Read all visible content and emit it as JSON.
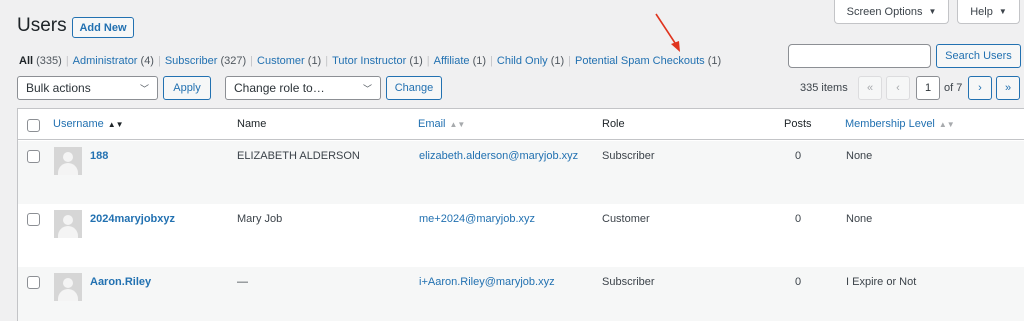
{
  "header": {
    "title": "Users",
    "add_new_label": "Add New",
    "screen_options_label": "Screen Options",
    "help_label": "Help"
  },
  "filters": {
    "all": {
      "label": "All",
      "count": "(335)"
    },
    "items": [
      {
        "label": "Administrator",
        "count": "(4)"
      },
      {
        "label": "Subscriber",
        "count": "(327)"
      },
      {
        "label": "Customer",
        "count": "(1)"
      },
      {
        "label": "Tutor Instructor",
        "count": "(1)"
      },
      {
        "label": "Affiliate",
        "count": "(1)"
      },
      {
        "label": "Child Only",
        "count": "(1)"
      },
      {
        "label": "Potential Spam Checkouts",
        "count": "(1)"
      }
    ]
  },
  "search": {
    "value": "",
    "button_label": "Search Users"
  },
  "tablenav": {
    "bulk_actions_label": "Bulk actions",
    "apply_label": "Apply",
    "change_role_label": "Change role to…",
    "change_label": "Change",
    "items_count": "335 items",
    "first_page": "«",
    "prev_page": "‹",
    "current_page": "1",
    "of_pages": "of 7",
    "next_page": "›",
    "last_page": "»"
  },
  "table": {
    "columns": {
      "username": "Username",
      "name": "Name",
      "email": "Email",
      "role": "Role",
      "posts": "Posts",
      "membership": "Membership Level"
    },
    "rows": [
      {
        "username": "188",
        "name": "ELIZABETH ALDERSON",
        "email": "elizabeth.alderson@maryjob.xyz",
        "role": "Subscriber",
        "posts": "0",
        "membership": "None"
      },
      {
        "username": "2024maryjobxyz",
        "name": "Mary Job",
        "email": "me+2024@maryjob.xyz",
        "role": "Customer",
        "posts": "0",
        "membership": "None"
      },
      {
        "username": "Aaron.Riley",
        "name": "—",
        "email": "i+Aaron.Riley@maryjob.xyz",
        "role": "Subscriber",
        "posts": "0",
        "membership": "I Expire or Not"
      }
    ]
  },
  "colors": {
    "accent": "#2271b1",
    "annotation_arrow": "#e0341e"
  }
}
